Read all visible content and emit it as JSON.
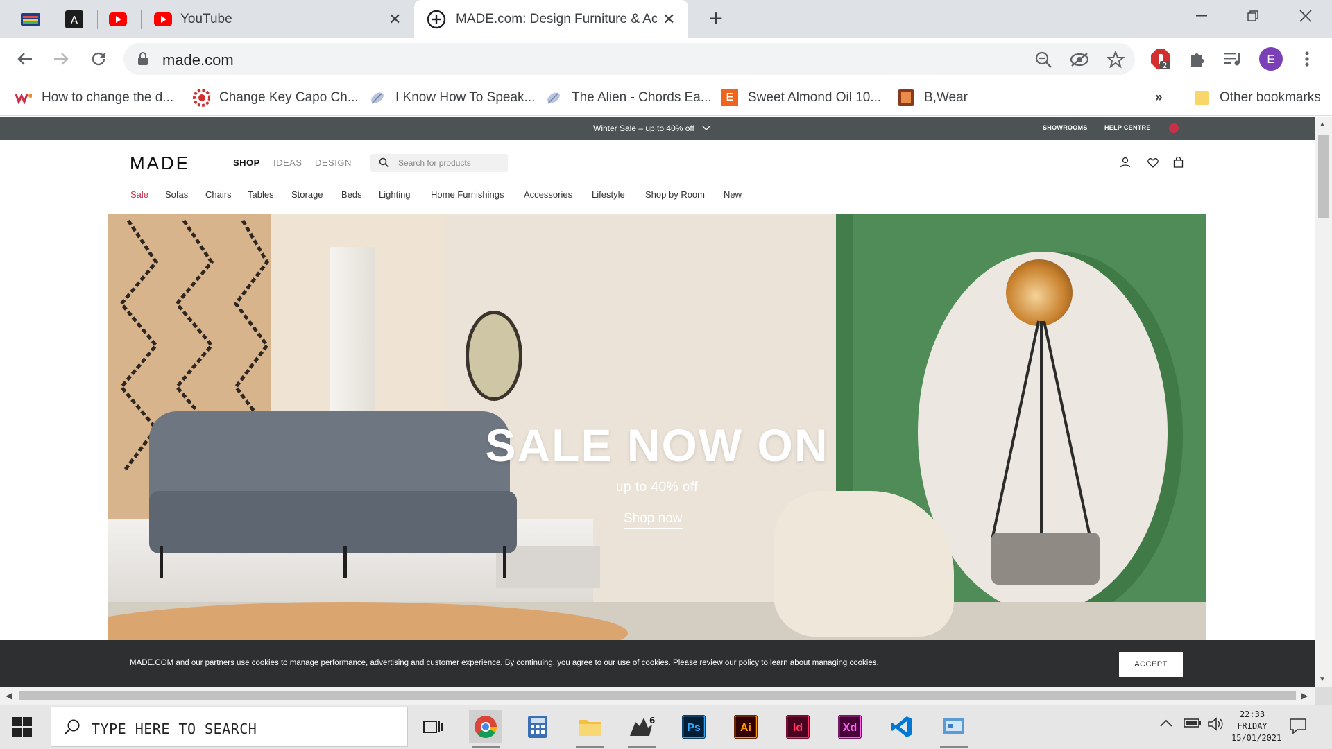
{
  "browser": {
    "tabs": [
      {
        "title": "YouTube",
        "icon": "youtube-icon"
      },
      {
        "title": "MADE.com: Design Furniture & Acce",
        "icon": "globe-plus-icon"
      }
    ],
    "new_tab_label": "+",
    "url": "made.com",
    "bookmarks": [
      {
        "label": "How to change the d...",
        "icon": "wk-favicon"
      },
      {
        "label": "Change Key Capo Ch...",
        "icon": "red-gear-favicon"
      },
      {
        "label": "I Know How To Speak...",
        "icon": "feather-favicon"
      },
      {
        "label": "The Alien - Chords Ea...",
        "icon": "feather-favicon"
      },
      {
        "label": "Sweet Almond Oil 10...",
        "icon": "etsy-favicon"
      },
      {
        "label": "B,Wear",
        "icon": "bwear-favicon"
      }
    ],
    "bookmarks_overflow": "»",
    "other_bookmarks": "Other bookmarks",
    "extension_badge": "2",
    "profile_initial": "E"
  },
  "site": {
    "promo": {
      "prefix": "Winter Sale – ",
      "link": "up to 40% off"
    },
    "top_links": [
      "SHOWROOMS",
      "HELP CENTRE"
    ],
    "logo": "MADE",
    "main_nav": [
      "SHOP",
      "IDEAS",
      "DESIGN"
    ],
    "search_placeholder": "Search for products",
    "categories": [
      "Sale",
      "Sofas",
      "Chairs",
      "Tables",
      "Storage",
      "Beds",
      "Lighting",
      "Home Furnishings",
      "Accessories",
      "Lifestyle",
      "Shop by Room",
      "New"
    ],
    "hero": {
      "title": "SALE NOW ON",
      "subtitle": "up to 40% off",
      "cta": "Shop now"
    },
    "cookie": {
      "brand": "MADE.COM",
      "text_1": " and our partners use cookies to manage performance, advertising and customer experience. By continuing, you agree to our use of cookies. Please review our ",
      "policy": "policy",
      "text_2": " to learn about managing cookies.",
      "accept": "ACCEPT"
    },
    "colors": {
      "sale_red": "#c9314a",
      "promo_bg": "#4d5255",
      "hero_green": "#4f8c57"
    }
  },
  "taskbar": {
    "search_placeholder": "TYPE HERE TO SEARCH",
    "apps": [
      "task-view",
      "chrome",
      "calculator",
      "file-explorer",
      "rhino",
      "photoshop",
      "illustrator",
      "indesign",
      "xd",
      "vscode",
      "control-panel"
    ],
    "rhino_badge": "6",
    "ps_label": "Ps",
    "ai_label": "Ai",
    "id_label": "Id",
    "xd_label": "Xd",
    "clock": {
      "time": "22:33",
      "day": "FRIDAY",
      "date": "15/01/2021"
    }
  }
}
